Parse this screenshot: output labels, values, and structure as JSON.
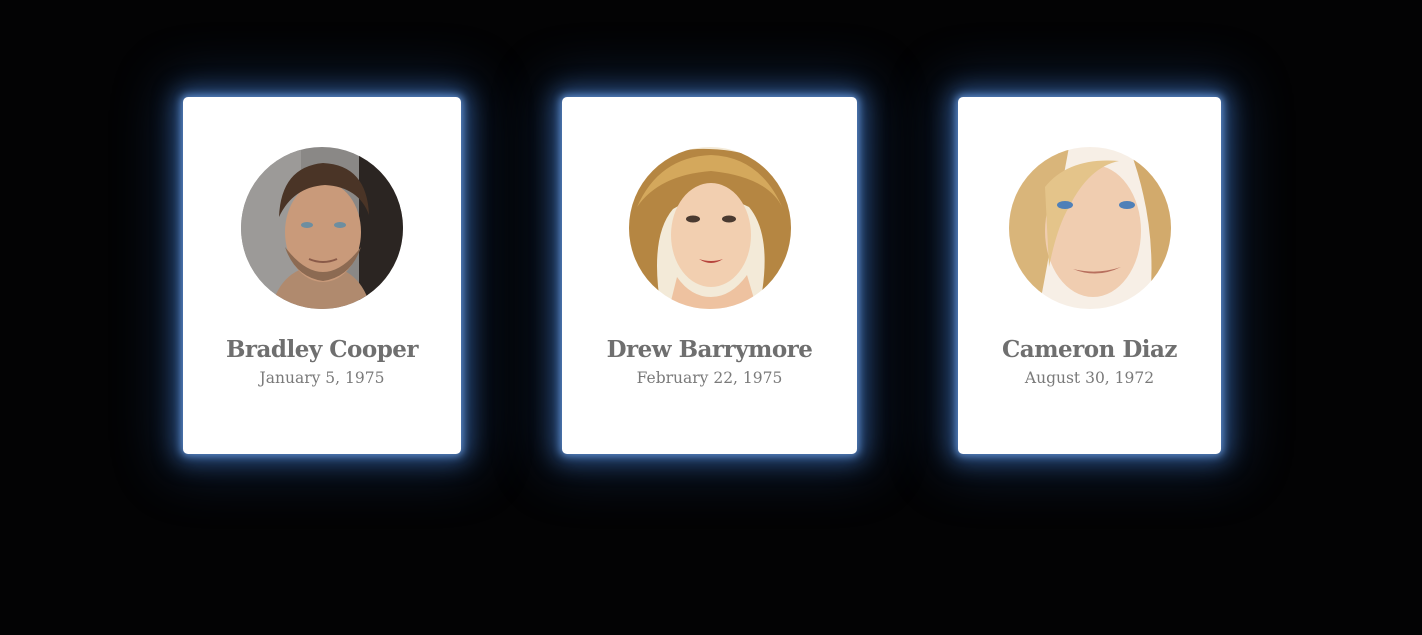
{
  "cards": [
    {
      "name": "Bradley Cooper",
      "birthdate": "January 5, 1975",
      "avatar_description": "portrait-photo-man-brown-hair-stubble"
    },
    {
      "name": "Drew Barrymore",
      "birthdate": "February 22, 1975",
      "avatar_description": "portrait-photo-woman-wavy-blonde-hair"
    },
    {
      "name": "Cameron Diaz",
      "birthdate": "August 30, 1972",
      "avatar_description": "portrait-photo-woman-blonde-hair-blue-eyes"
    }
  ],
  "colors": {
    "background": "#030304",
    "card": "#ffffff",
    "glow": "#4a7fd0",
    "name_text": "#6f6f6f",
    "date_text": "#7a7a7a"
  }
}
